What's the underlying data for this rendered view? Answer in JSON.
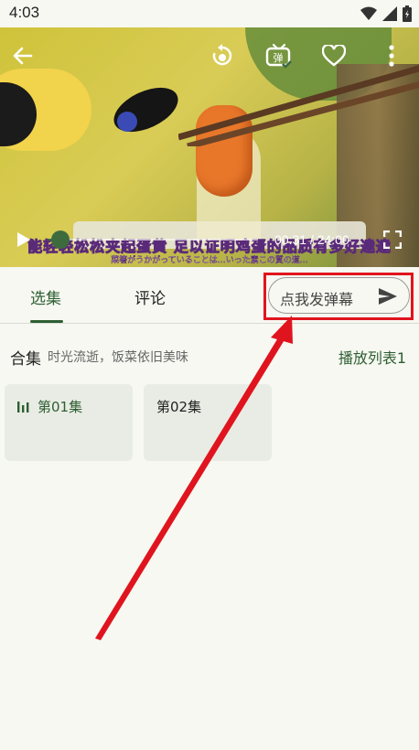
{
  "status_bar": {
    "time": "4:03"
  },
  "video": {
    "subtitle_main": "能轻轻松松夹起蛋黄 足以证明鸡蛋的品质有多好達達",
    "subtitle_jp": "菜箸がうかがっていることは…いった素この質の道…",
    "time_current": "00:31",
    "time_total": "24:00",
    "time_display": "00:31 / 24:00",
    "progress": 0.06
  },
  "tabs": [
    {
      "label": "选集",
      "active": true
    },
    {
      "label": "评论",
      "active": false
    }
  ],
  "danmaku": {
    "placeholder": "点我发弹幕"
  },
  "collection": {
    "title": "合集",
    "description": "时光流逝，饭菜依旧美味",
    "playlist_label": "播放列表1"
  },
  "episodes": [
    {
      "label": "第01集",
      "active": true
    },
    {
      "label": "第02集",
      "active": false
    }
  ],
  "colors": {
    "accent": "#2e5e33",
    "annotation_red": "#e0141e",
    "background": "#f6f8f1"
  },
  "icons": {
    "back": "arrow-left-icon",
    "replay": "replay-icon",
    "danmaku_toggle": "danmaku-tv-icon",
    "favorite": "heart-icon",
    "more": "more-vertical-icon",
    "play": "play-icon",
    "fullscreen": "fullscreen-icon",
    "send": "send-icon",
    "playing": "equalizer-icon"
  }
}
